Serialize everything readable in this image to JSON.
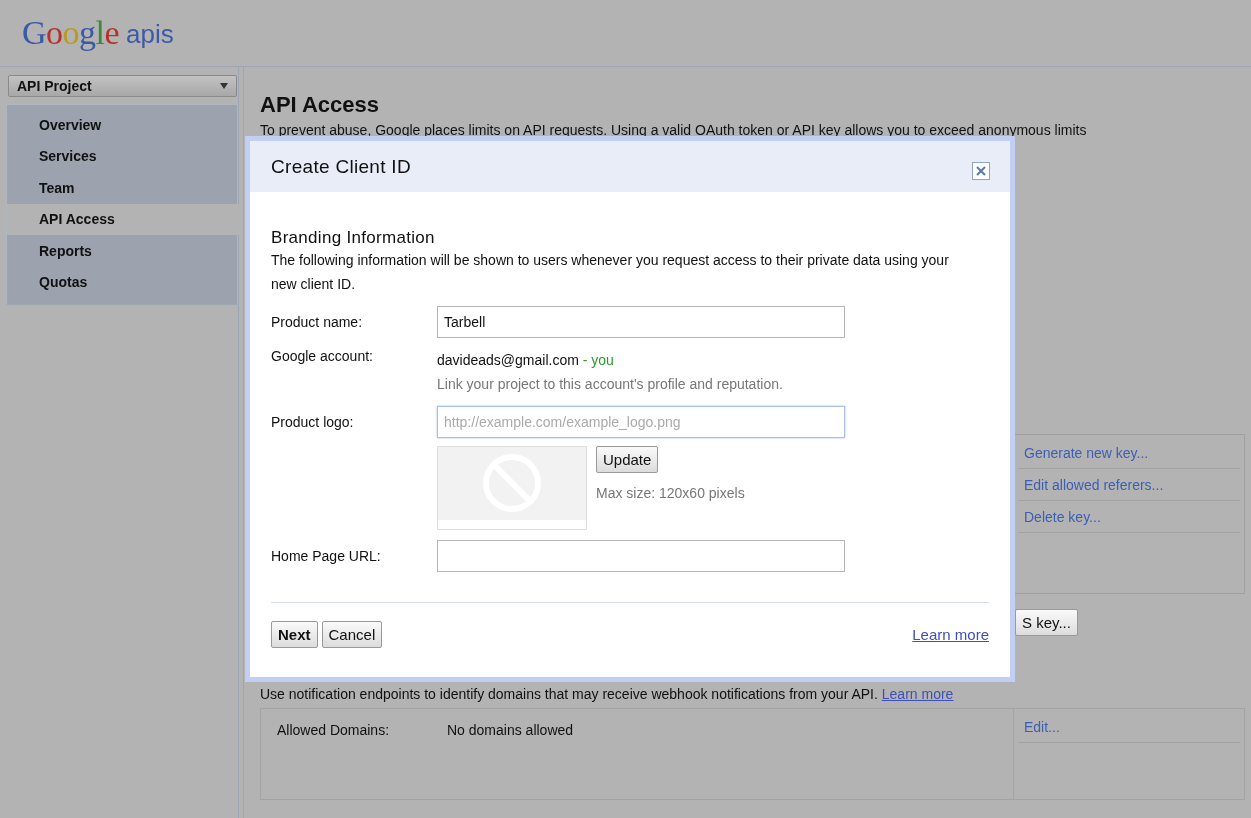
{
  "header": {
    "logo": "Google",
    "product": "apis"
  },
  "sidebar": {
    "project": "API Project",
    "items": [
      {
        "label": "Overview",
        "selected": false
      },
      {
        "label": "Services",
        "selected": false
      },
      {
        "label": "Team",
        "selected": false
      },
      {
        "label": "API Access",
        "selected": true
      },
      {
        "label": "Reports",
        "selected": false
      },
      {
        "label": "Quotas",
        "selected": false
      }
    ]
  },
  "main": {
    "title": "API Access",
    "description": "To prevent abuse, Google places limits on API requests. Using a valid OAuth token or API key allows you to exceed anonymous limits",
    "key_links": [
      "Generate new key...",
      "Edit allowed referers...",
      "Delete key..."
    ],
    "key_button": "S key...",
    "notification": "Use notification endpoints to identify domains that may receive webhook notifications from your API.",
    "notification_link": "Learn more",
    "domains": {
      "label": "Allowed Domains:",
      "value": "No domains allowed",
      "edit": "Edit..."
    }
  },
  "dialog": {
    "title": "Create Client ID",
    "heading": "Branding Information",
    "description": "The following information will be shown to users whenever you request access to their private data using your new client ID.",
    "product_name": {
      "label": "Product name:",
      "value": "Tarbell"
    },
    "account": {
      "label": "Google account:",
      "email": "davideads@gmail.com",
      "tag": "- you",
      "hint": "Link your project to this account's profile and reputation."
    },
    "logo": {
      "label": "Product logo:",
      "placeholder": "http://example.com/example_logo.png",
      "button": "Update",
      "max_size": "Max size: 120x60 pixels"
    },
    "home_page": {
      "label": "Home Page URL:"
    },
    "buttons": [
      "Next",
      "Cancel"
    ],
    "learn_more": "Learn more"
  }
}
